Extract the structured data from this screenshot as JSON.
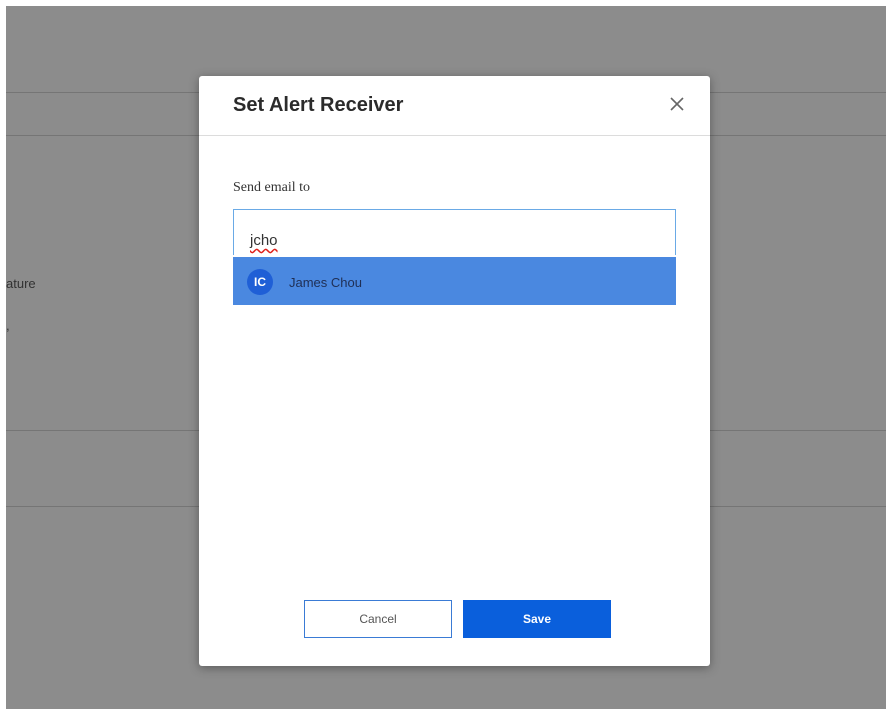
{
  "background": {
    "label_ature": "ature",
    "label_small": ","
  },
  "modal": {
    "title": "Set Alert Receiver",
    "close_icon": "close-icon",
    "field_label": "Send email to",
    "input_value": "jcho",
    "suggestion": {
      "initials": "IC",
      "name": "James Chou"
    },
    "cancel_label": "Cancel",
    "save_label": "Save"
  },
  "colors": {
    "accent": "#0a5fdc",
    "suggestion_bg": "#4a88e0",
    "overlay": "#8a8a8a"
  }
}
